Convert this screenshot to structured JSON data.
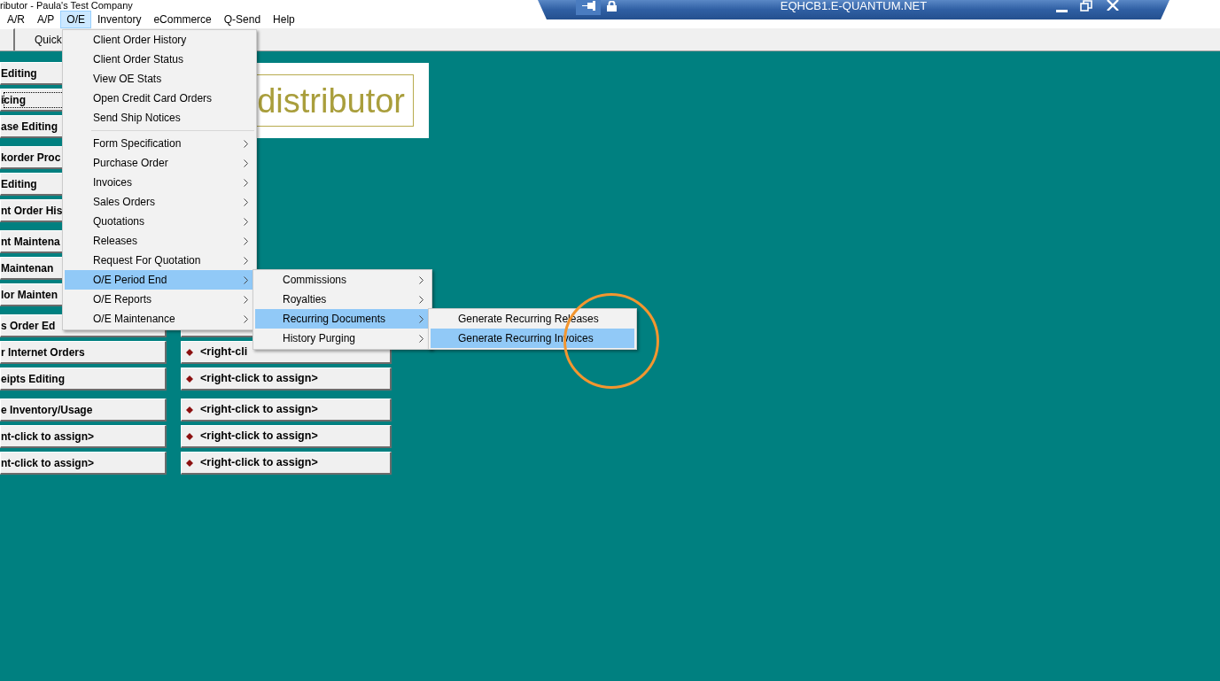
{
  "window": {
    "title": "ributor - Paula's Test Company"
  },
  "menu_bar": [
    {
      "label": "A/R",
      "selected": false
    },
    {
      "label": "A/P",
      "selected": false
    },
    {
      "label": "O/E",
      "selected": true
    },
    {
      "label": "Inventory",
      "selected": false
    },
    {
      "label": "eCommerce",
      "selected": false
    },
    {
      "label": "Q-Send",
      "selected": false
    },
    {
      "label": "Help",
      "selected": false
    }
  ],
  "remote_bar": {
    "title": "EQHCB1.E-QUANTUM.NET",
    "pinned": true
  },
  "toolbar": {
    "label": "Quick"
  },
  "logo": {
    "text": "distributor"
  },
  "shortcut_groups": [
    {
      "left": [
        {
          "label": "Editing",
          "focused": false
        },
        {
          "label": "icing",
          "focused": true
        },
        {
          "label": "ase Editing",
          "focused": false
        }
      ]
    },
    {
      "left": [
        {
          "label": "korder Proc",
          "focused": false
        },
        {
          "label": "Editing",
          "focused": false
        },
        {
          "label": "nt Order His",
          "focused": false
        }
      ]
    },
    {
      "left": [
        {
          "label": "nt Maintena",
          "focused": false
        },
        {
          "label": "Maintenan",
          "focused": false
        },
        {
          "label": "lor Mainten",
          "focused": false
        }
      ]
    },
    {
      "left": [
        {
          "label": "s Order Ed",
          "focused": false
        },
        {
          "label": "r Internet Orders",
          "focused": false
        },
        {
          "label": "eipts Editing",
          "focused": false
        }
      ],
      "right": [
        {
          "kind": "blank"
        },
        {
          "kind": "assign",
          "label": "<right-cli"
        },
        {
          "kind": "assign",
          "label": "<right-click to assign>"
        }
      ]
    },
    {
      "left": [
        {
          "label": "e Inventory/Usage",
          "focused": false
        },
        {
          "label": "nt-click to assign>",
          "focused": false
        },
        {
          "label": "nt-click to assign>",
          "focused": false
        }
      ],
      "right": [
        {
          "kind": "assign",
          "label": "<right-click to assign>"
        },
        {
          "kind": "assign",
          "label": "<right-click to assign>"
        },
        {
          "kind": "assign",
          "label": "<right-click to assign>"
        }
      ]
    }
  ],
  "oe_menu": [
    {
      "kind": "command",
      "label": "Client Order History",
      "selected": false
    },
    {
      "kind": "command",
      "label": "Client Order Status",
      "selected": false
    },
    {
      "kind": "command",
      "label": "View OE Stats",
      "selected": false
    },
    {
      "kind": "command",
      "label": "Open Credit Card Orders",
      "selected": false
    },
    {
      "kind": "command",
      "label": "Send Ship Notices",
      "selected": false
    },
    {
      "kind": "separator"
    },
    {
      "kind": "submenu",
      "label": "Form Specification",
      "selected": false
    },
    {
      "kind": "submenu",
      "label": "Purchase Order",
      "selected": false
    },
    {
      "kind": "submenu",
      "label": "Invoices",
      "selected": false
    },
    {
      "kind": "submenu",
      "label": "Sales Orders",
      "selected": false
    },
    {
      "kind": "submenu",
      "label": "Quotations",
      "selected": false
    },
    {
      "kind": "submenu",
      "label": "Releases",
      "selected": false
    },
    {
      "kind": "submenu",
      "label": "Request For Quotation",
      "selected": false
    },
    {
      "kind": "submenu",
      "label": "O/E Period End",
      "selected": true,
      "children": [
        {
          "kind": "submenu",
          "label": "Commissions",
          "selected": false
        },
        {
          "kind": "submenu",
          "label": "Royalties",
          "selected": false
        },
        {
          "kind": "submenu",
          "label": "Recurring Documents",
          "selected": true,
          "children": [
            {
              "kind": "command",
              "label": "Generate Recurring Releases",
              "selected": false
            },
            {
              "kind": "command",
              "label": "Generate Recurring Invoices",
              "selected": true
            }
          ]
        },
        {
          "kind": "submenu",
          "label": "History Purging",
          "selected": false
        }
      ]
    },
    {
      "kind": "submenu",
      "label": "O/E Reports",
      "selected": false
    },
    {
      "kind": "submenu",
      "label": "O/E Maintenance",
      "selected": false
    }
  ],
  "annotations": [
    {
      "kind": "circle"
    }
  ]
}
